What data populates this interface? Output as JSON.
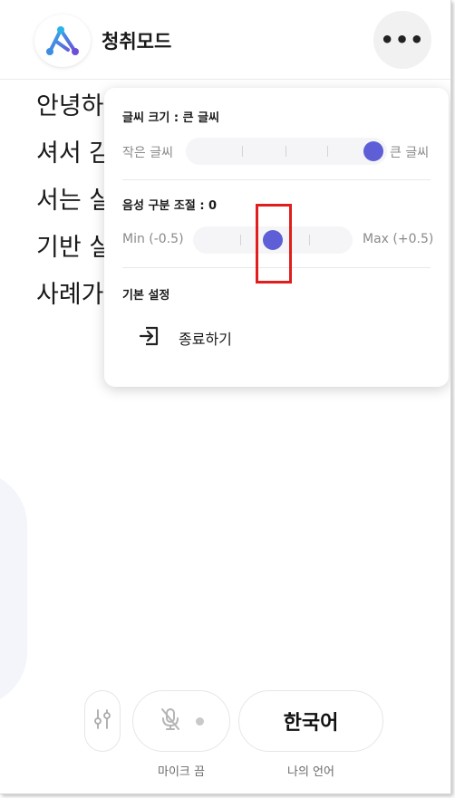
{
  "header": {
    "app_title": "청취모드",
    "more_label": "•••"
  },
  "transcript": {
    "lines": [
      "안녕하",
      "셔서 감",
      "서는 실",
      "기반 실",
      "사례가"
    ]
  },
  "settings_popup": {
    "font_size": {
      "title": "글씨 크기 : 큰 글씨",
      "min_label": "작은 글씨",
      "max_label": "큰 글씨",
      "value_fraction": 1.0
    },
    "voice_separation": {
      "title": "음성 구분 조절 : 0",
      "min_label": "Min (-0.5)",
      "max_label": "Max (+0.5)",
      "value_fraction": 0.5
    },
    "basic_settings": {
      "title": "기본 설정",
      "exit_label": "종료하기"
    }
  },
  "bottom_bar": {
    "mic_caption": "마이크 끔",
    "language_label": "한국어",
    "language_caption": "나의 언어"
  },
  "colors": {
    "accent": "#5e5fd6",
    "highlight": "#e01e1e"
  },
  "icons": [
    "logo-icon",
    "more-icon",
    "exit-icon",
    "settings-sliders-icon",
    "mic-off-icon"
  ]
}
